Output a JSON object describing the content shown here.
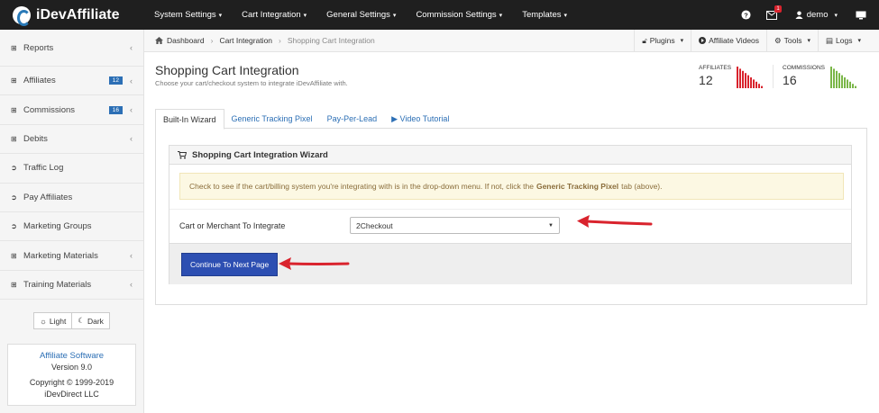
{
  "brand": {
    "name": "iDevAffiliate"
  },
  "topnav": {
    "items": [
      "System Settings",
      "Cart Integration",
      "General Settings",
      "Commission Settings",
      "Templates"
    ],
    "notifications_count": "1",
    "user": "demo"
  },
  "sidebar": {
    "items": [
      {
        "label": "Reports",
        "icon": "plus-square-icon",
        "badge": "",
        "chevron": "‹"
      },
      {
        "label": "Affiliates",
        "icon": "plus-square-icon",
        "badge": "12",
        "chevron": "‹"
      },
      {
        "label": "Commissions",
        "icon": "plus-square-icon",
        "badge": "16",
        "chevron": "‹"
      },
      {
        "label": "Debits",
        "icon": "plus-square-icon",
        "badge": "",
        "chevron": "‹"
      },
      {
        "label": "Traffic Log",
        "icon": "circle-arrow-icon",
        "badge": "",
        "chevron": ""
      },
      {
        "label": "Pay Affiliates",
        "icon": "circle-arrow-icon",
        "badge": "",
        "chevron": ""
      },
      {
        "label": "Marketing Groups",
        "icon": "circle-arrow-icon",
        "badge": "",
        "chevron": ""
      },
      {
        "label": "Marketing Materials",
        "icon": "plus-square-icon",
        "badge": "",
        "chevron": "‹"
      },
      {
        "label": "Training Materials",
        "icon": "plus-square-icon",
        "badge": "",
        "chevron": "‹"
      }
    ],
    "theme": {
      "light": "Light",
      "dark": "Dark"
    },
    "info": {
      "product": "Affiliate Software",
      "version": "Version 9.0",
      "copyright": "Copyright © 1999-2019",
      "company": "iDevDirect LLC"
    }
  },
  "breadcrumb": {
    "home": "Dashboard",
    "section": "Cart Integration",
    "current": "Shopping Cart Integration"
  },
  "toolbar": {
    "plugins": "Plugins",
    "videos": "Affiliate Videos",
    "tools": "Tools",
    "logs": "Logs"
  },
  "page": {
    "title": "Shopping Cart Integration",
    "subtitle": "Choose your cart/checkout system to integrate iDevAffiliate with."
  },
  "stats": {
    "affiliates": {
      "label": "AFFILIATES",
      "value": "12",
      "color": "#d9232d",
      "bars": [
        10,
        9,
        8,
        7,
        6,
        5,
        4,
        3,
        2,
        1
      ]
    },
    "commissions": {
      "label": "COMMISSIONS",
      "value": "16",
      "color": "#7ab648",
      "bars": [
        10,
        9,
        8,
        7,
        6,
        5,
        4,
        3,
        2,
        1
      ]
    }
  },
  "tabs": [
    "Built-In Wizard",
    "Generic Tracking Pixel",
    "Pay-Per-Lead",
    "▶ Video Tutorial"
  ],
  "wizard": {
    "title": "Shopping Cart Integration Wizard",
    "notice_pre": "Check to see if the cart/billing system you're integrating with is in the drop-down menu. If not, click the",
    "notice_bold": "Generic Tracking Pixel",
    "notice_post": "tab (above).",
    "field_label": "Cart or Merchant To Integrate",
    "selected": "2Checkout",
    "continue": "Continue To Next Page"
  },
  "colors": {
    "accent": "#2c6fb5",
    "button": "#2d4fb2",
    "arrow": "#d9232d"
  }
}
